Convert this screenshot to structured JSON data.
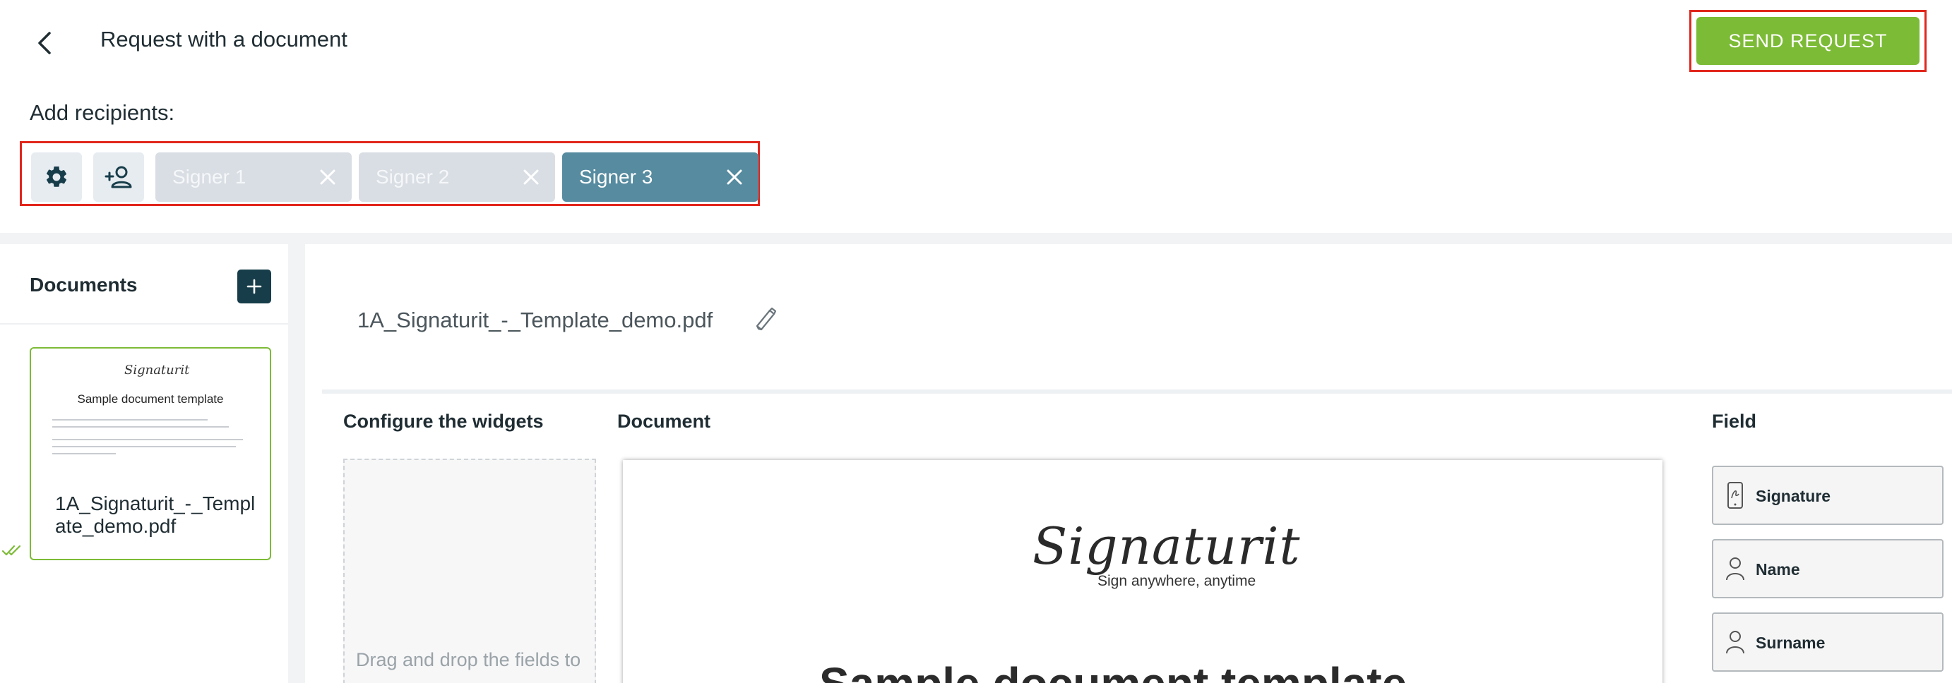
{
  "header": {
    "title": "Request with a document",
    "send_label": "SEND REQUEST"
  },
  "recipients": {
    "label": "Add recipients:",
    "signers": [
      "Signer 1",
      "Signer 2",
      "Signer 3"
    ],
    "active_signer": "Signer 3"
  },
  "documents": {
    "title": "Documents",
    "items": [
      {
        "name": "1A_Signaturit_-_Template_demo.pdf",
        "thumbnail_title": "Sample document template",
        "thumbnail_logo": "Signaturit"
      }
    ]
  },
  "main": {
    "file_name": "1A_Signaturit_-_Template_demo.pdf",
    "config_title": "Configure the widgets",
    "drop_hint": "Drag and drop the fields to",
    "document_title": "Document",
    "doc_logo": "Signaturit",
    "doc_tagline": "Sign anywhere, anytime",
    "doc_heading": "Sample document template",
    "field_title": "Field",
    "fields": [
      "Signature",
      "Name",
      "Surname"
    ]
  },
  "colors": {
    "accent_green": "#7cbb36",
    "signer_active": "#568ba0",
    "highlight_red": "#e1261c",
    "dark_teal": "#173d4a"
  },
  "icons": [
    "back-chevron-icon",
    "gear-icon",
    "add-person-icon",
    "close-icon",
    "plus-icon",
    "pencil-icon",
    "double-check-icon",
    "signature-icon",
    "person-icon"
  ]
}
